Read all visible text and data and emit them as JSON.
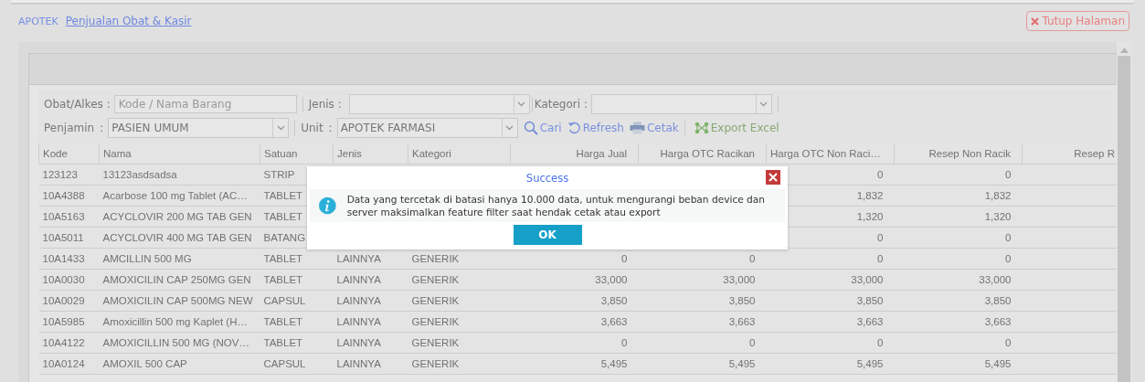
{
  "breadcrumb": {
    "module": "APOTEK",
    "page": "Penjualan Obat & Kasir"
  },
  "close_page_button": {
    "label": "Tutup Halaman"
  },
  "filters": [
    {
      "kind": "text",
      "label": "Obat/Alkes :",
      "placeholder": "Kode / Nama Barang"
    },
    {
      "kind": "combo",
      "label": "Jenis :"
    },
    {
      "kind": "combo",
      "label": "Kategori :"
    },
    {
      "kind": "combo",
      "label": "Penjamin",
      "separator": ":",
      "value": "PASIEN UMUM"
    },
    {
      "kind": "combo",
      "label": "Unit",
      "separator": ":",
      "value": "APOTEK FARMASI"
    }
  ],
  "toolbar_buttons": [
    {
      "kind": "search",
      "label": "Cari"
    },
    {
      "kind": "refresh",
      "label": "Refresh"
    },
    {
      "kind": "print",
      "label": "Cetak"
    },
    {
      "kind": "excel",
      "label": "Export Excel"
    }
  ],
  "table": {
    "columns": [
      "Kode",
      "Nama",
      "Satuan",
      "Jenis",
      "Kategori",
      "Harga Jual",
      "Harga OTC Racikan",
      "Harga OTC Non Raci…",
      "Resep Non Racik",
      "Resep R"
    ],
    "rows": [
      {
        "cells": [
          "123123",
          "13123asdsadsa",
          "STRIP",
          null,
          null,
          null,
          null,
          "0",
          "0",
          null
        ]
      },
      {
        "cells": [
          "10A4388",
          "Acarbose 100 mg Tablet (AC…",
          "TABLET",
          null,
          null,
          null,
          null,
          "1,832",
          "1,832",
          null
        ]
      },
      {
        "cells": [
          "10A5163",
          "ACYCLOVIR 200 MG TAB GEN",
          "TABLET",
          null,
          null,
          null,
          null,
          "1,320",
          "1,320",
          null
        ]
      },
      {
        "cells": [
          "10A5011",
          "ACYCLOVIR 400 MG TAB GEN",
          "BATANG",
          null,
          null,
          null,
          null,
          "0",
          "0",
          null
        ]
      },
      {
        "cells": [
          "10A1433",
          "AMCILLIN 500 MG",
          "TABLET",
          "LAINNYA",
          "GENERIK",
          "0",
          "0",
          "0",
          "0",
          null
        ]
      },
      {
        "cells": [
          "10A0030",
          "AMOXICILIN CAP 250MG GEN",
          "TABLET",
          "LAINNYA",
          "GENERIK",
          "33,000",
          "33,000",
          "33,000",
          "33,000",
          null
        ]
      },
      {
        "cells": [
          "10A0029",
          "AMOXICILIN CAP 500MG NEW",
          "CAPSUL",
          "LAINNYA",
          "GENERIK",
          "3,850",
          "3,850",
          "3,850",
          "3,850",
          null
        ]
      },
      {
        "cells": [
          "10A5985",
          "Amoxicillin 500 mg Kaplet (H…",
          "TABLET",
          "LAINNYA",
          "GENERIK",
          "3,663",
          "3,663",
          "3,663",
          "3,663",
          null
        ]
      },
      {
        "cells": [
          "10A4122",
          "AMOXICILLIN 500 MG (NOV…",
          "TABLET",
          "LAINNYA",
          "GENERIK",
          "0",
          "0",
          "0",
          "0",
          null
        ]
      },
      {
        "cells": [
          "10A0124",
          "AMOXIL 500 CAP",
          "CAPSUL",
          "LAINNYA",
          "GENERIK",
          "5,495",
          "5,495",
          "5,495",
          "5,495",
          null
        ]
      }
    ]
  },
  "dialog": {
    "title": "Success",
    "kind": "info",
    "message": "Data yang tercetak di batasi hanya 10.000 data, untuk mengurangi beban device dan server maksimalkan feature filter saat hendak cetak atau export",
    "button": "OK"
  }
}
